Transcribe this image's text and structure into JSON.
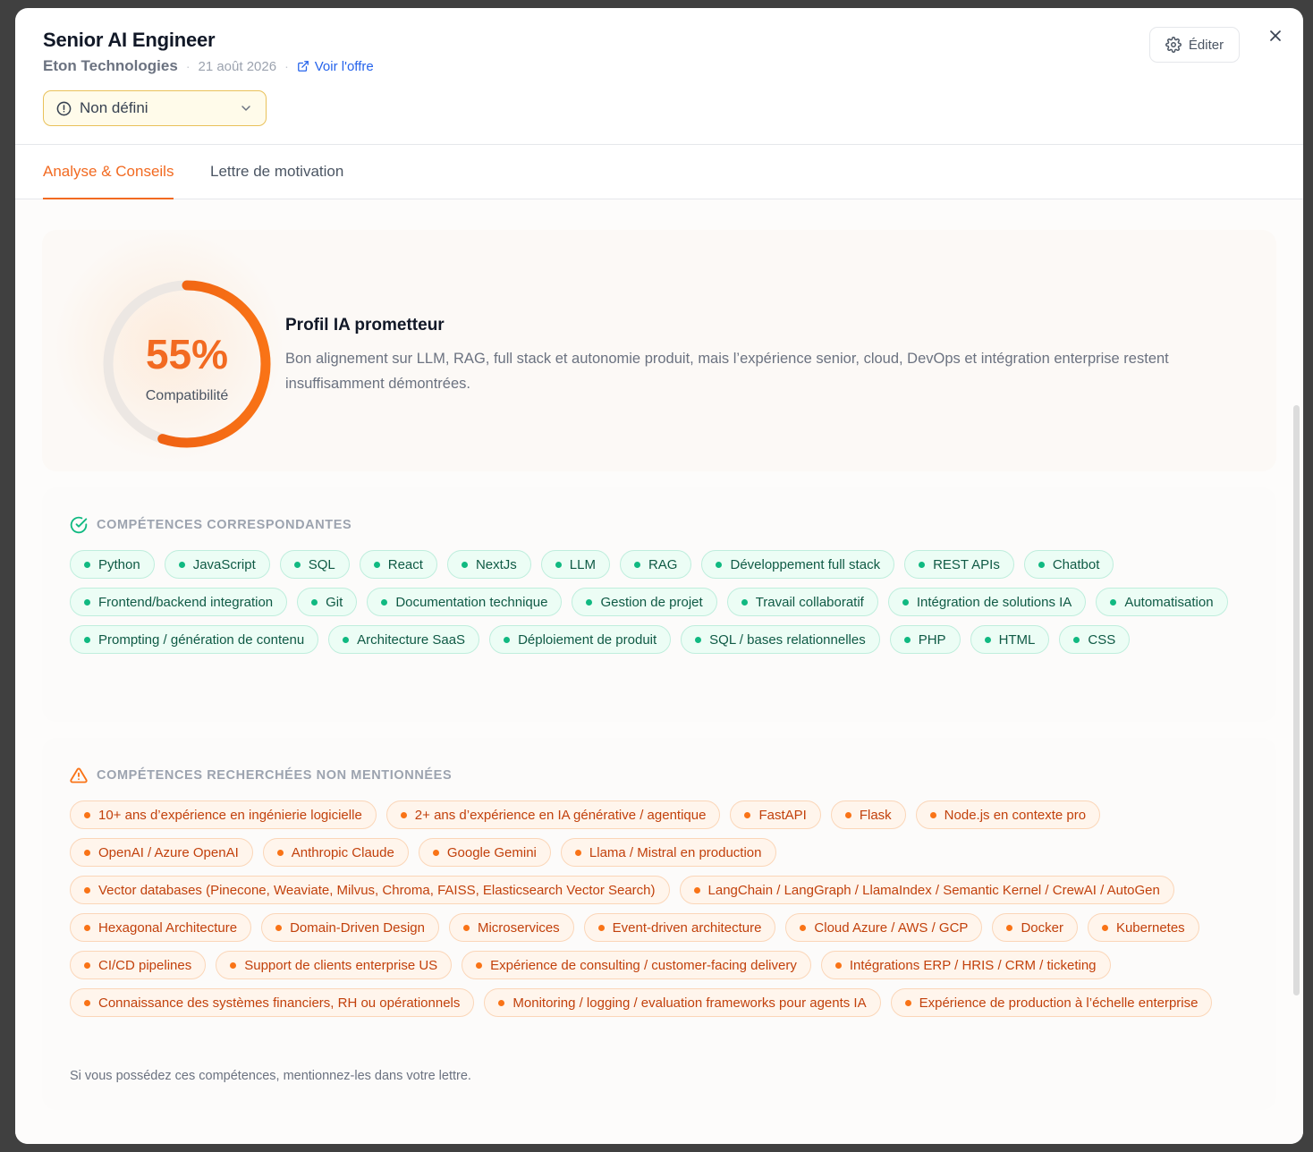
{
  "job": {
    "title": "Senior AI Engineer",
    "company": "Eton Technologies",
    "date": "21 août 2026",
    "offer_link": "Voir l'offre"
  },
  "status": {
    "value": "Non défini",
    "icon": "alert-circle-icon"
  },
  "edit_label": "Éditer",
  "tabs": [
    {
      "label": "Analyse & Conseils",
      "active": true
    },
    {
      "label": "Lettre de motivation",
      "active": false
    }
  ],
  "score": {
    "percent_label": "55%",
    "percent": 55,
    "caption": "Compatibilité",
    "verdict_title": "Profil IA prometteur",
    "verdict_text": "Bon alignement sur LLM, RAG, full stack et autonomie produit, mais l’expérience senior, cloud, DevOps et intégration enterprise restent insuffisamment démontrées."
  },
  "matching": {
    "title": "COMPÉTENCES CORRESPONDANTES",
    "skills": [
      "Python",
      "JavaScript",
      "SQL",
      "React",
      "NextJs",
      "LLM",
      "RAG",
      "Développement full stack",
      "REST APIs",
      "Chatbot",
      "Frontend/backend integration",
      "Git",
      "Documentation technique",
      "Gestion de projet",
      "Travail collaboratif",
      "Intégration de solutions IA",
      "Automatisation",
      "Prompting / génération de contenu",
      "Architecture SaaS",
      "Déploiement de produit",
      "SQL / bases relationnelles",
      "PHP",
      "HTML",
      "CSS"
    ]
  },
  "missing": {
    "title": "COMPÉTENCES RECHERCHÉES NON MENTIONNÉES",
    "skills": [
      "10+ ans d’expérience en ingénierie logicielle",
      "2+ ans d’expérience en IA générative / agentique",
      "FastAPI",
      "Flask",
      "Node.js en contexte pro",
      "OpenAI / Azure OpenAI",
      "Anthropic Claude",
      "Google Gemini",
      "Llama / Mistral en production",
      "Vector databases (Pinecone, Weaviate, Milvus, Chroma, FAISS, Elasticsearch Vector Search)",
      "LangChain / LangGraph / LlamaIndex / Semantic Kernel / CrewAI / AutoGen",
      "Hexagonal Architecture",
      "Domain-Driven Design",
      "Microservices",
      "Event-driven architecture",
      "Cloud Azure / AWS / GCP",
      "Docker",
      "Kubernetes",
      "CI/CD pipelines",
      "Support de clients enterprise US",
      "Expérience de consulting / customer-facing delivery",
      "Intégrations ERP / HRIS / CRM / ticketing",
      "Connaissance des systèmes financiers, RH ou opérationnels",
      "Monitoring / logging / evaluation frameworks pour agents IA",
      "Expérience de production à l’échelle enterprise"
    ],
    "hint": "Si vous possédez ces compétences, mentionnez-les dans votre lettre."
  },
  "colors": {
    "accent": "#f26a21",
    "match": "#10b981",
    "missing": "#f97316"
  }
}
